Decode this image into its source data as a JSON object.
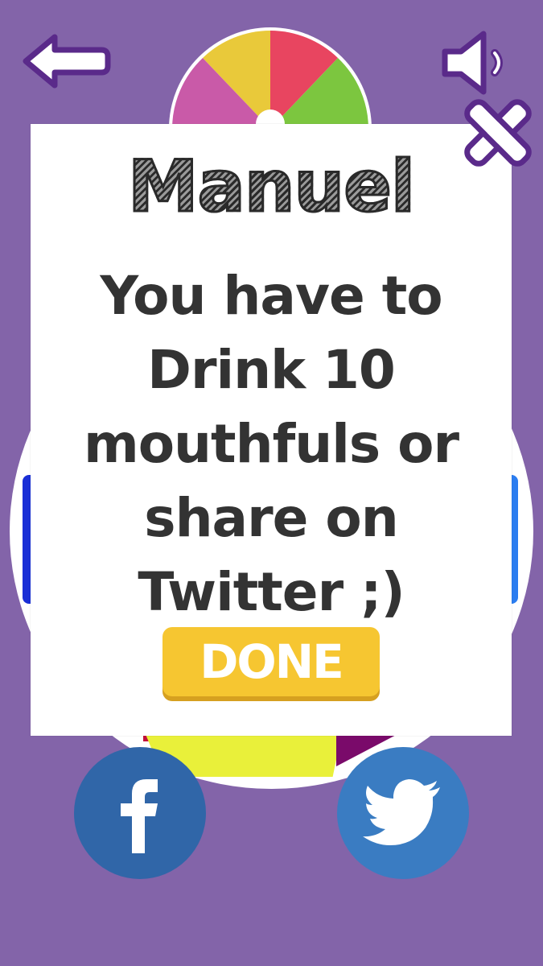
{
  "dialog": {
    "player_name": "Manuel",
    "message_lines": [
      "You have to",
      "Drink 10",
      "mouthfuls or",
      "share on",
      "Twitter ;)"
    ],
    "done_label": "DONE"
  },
  "icons": {
    "back": "arrow-left-icon",
    "sound": "speaker-icon",
    "close": "close-x-icon",
    "facebook": "facebook-icon",
    "twitter": "twitter-bird-icon"
  },
  "colors": {
    "background": "#8364a9",
    "done_button": "#f6c631",
    "facebook": "#3066a8",
    "twitter": "#3a7cc2",
    "wheel_segments": [
      "#e9c93a",
      "#e84560",
      "#7cc63f",
      "#c95aa8"
    ]
  }
}
